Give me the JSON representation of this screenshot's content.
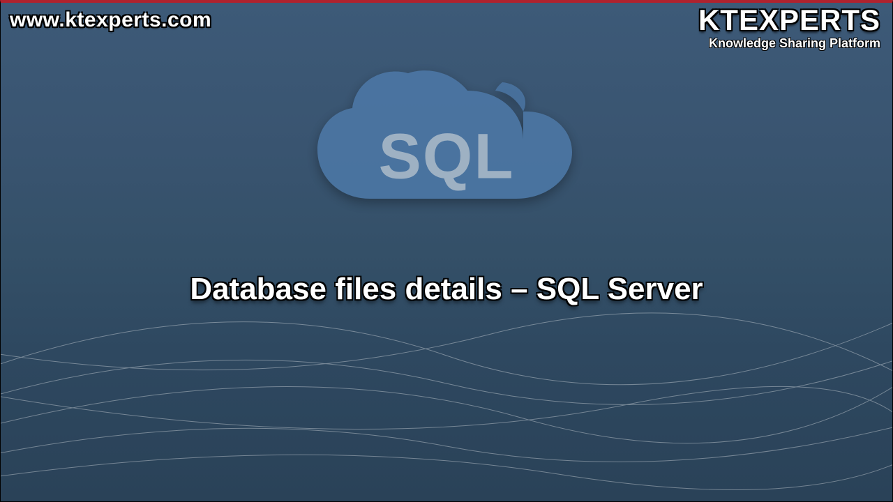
{
  "website_url": "www.ktexperts.com",
  "brand": {
    "title": "KTEXPERTS",
    "tagline": "Knowledge Sharing Platform"
  },
  "cloud_label": "SQL",
  "main_title": "Database files details – SQL Server"
}
